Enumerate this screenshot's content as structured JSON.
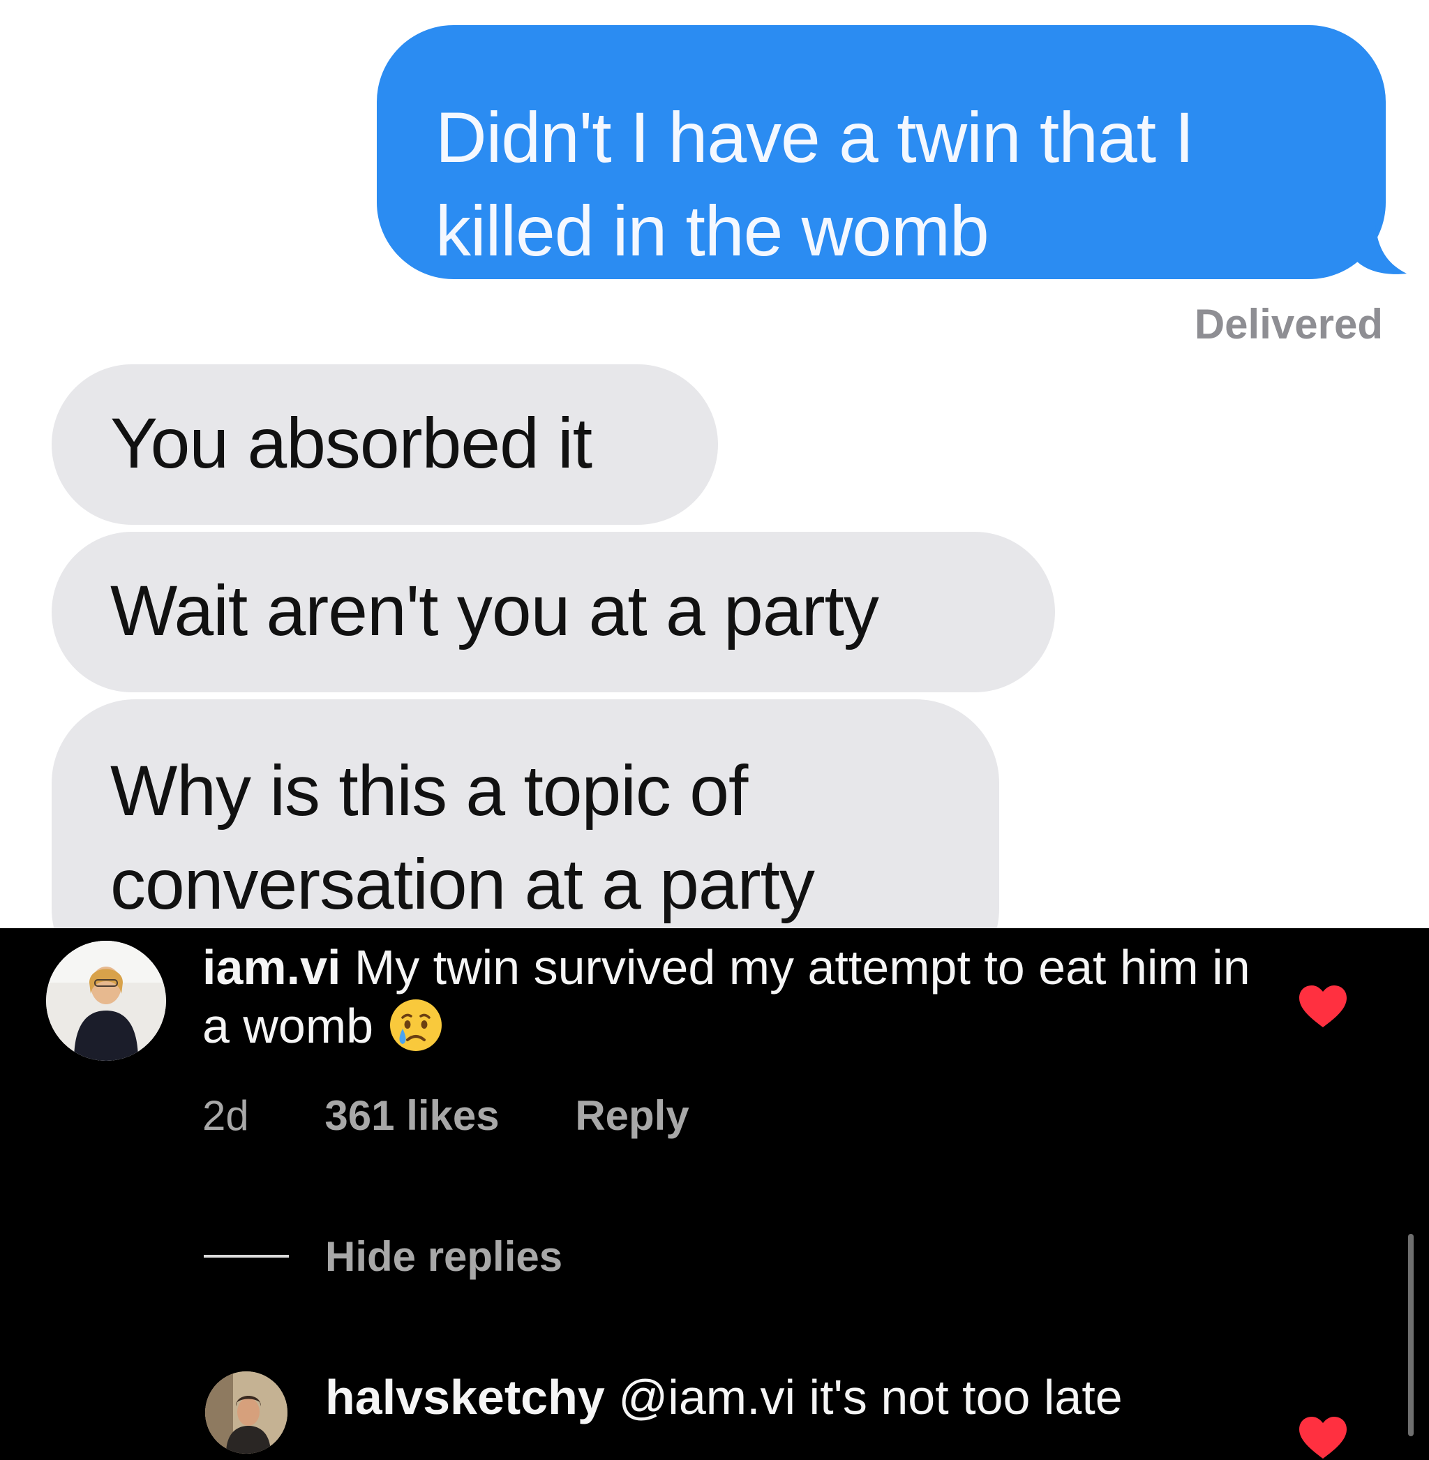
{
  "conversation": {
    "sent_message": "Didn't I have a twin that I killed in the womb",
    "status": "Delivered",
    "received_messages": [
      "You absorbed it",
      "Wait aren't you at a party",
      "Why is this a topic of conversation at a party"
    ]
  },
  "comments": [
    {
      "username": "iam.vi",
      "text": "My twin survived my attempt to eat him in a womb",
      "emoji": "crying-face",
      "time": "2d",
      "likes": "361 likes",
      "reply_label": "Reply",
      "liked": true
    }
  ],
  "replies_toggle": "Hide replies",
  "replies": [
    {
      "username": "halvsketchy",
      "text": "@iam.vi it's not too late",
      "liked": true
    }
  ],
  "colors": {
    "sent_bubble": "#2b8cf2",
    "received_bubble": "#e7e7ea",
    "heart": "#ff3040",
    "comment_background": "#000000"
  }
}
